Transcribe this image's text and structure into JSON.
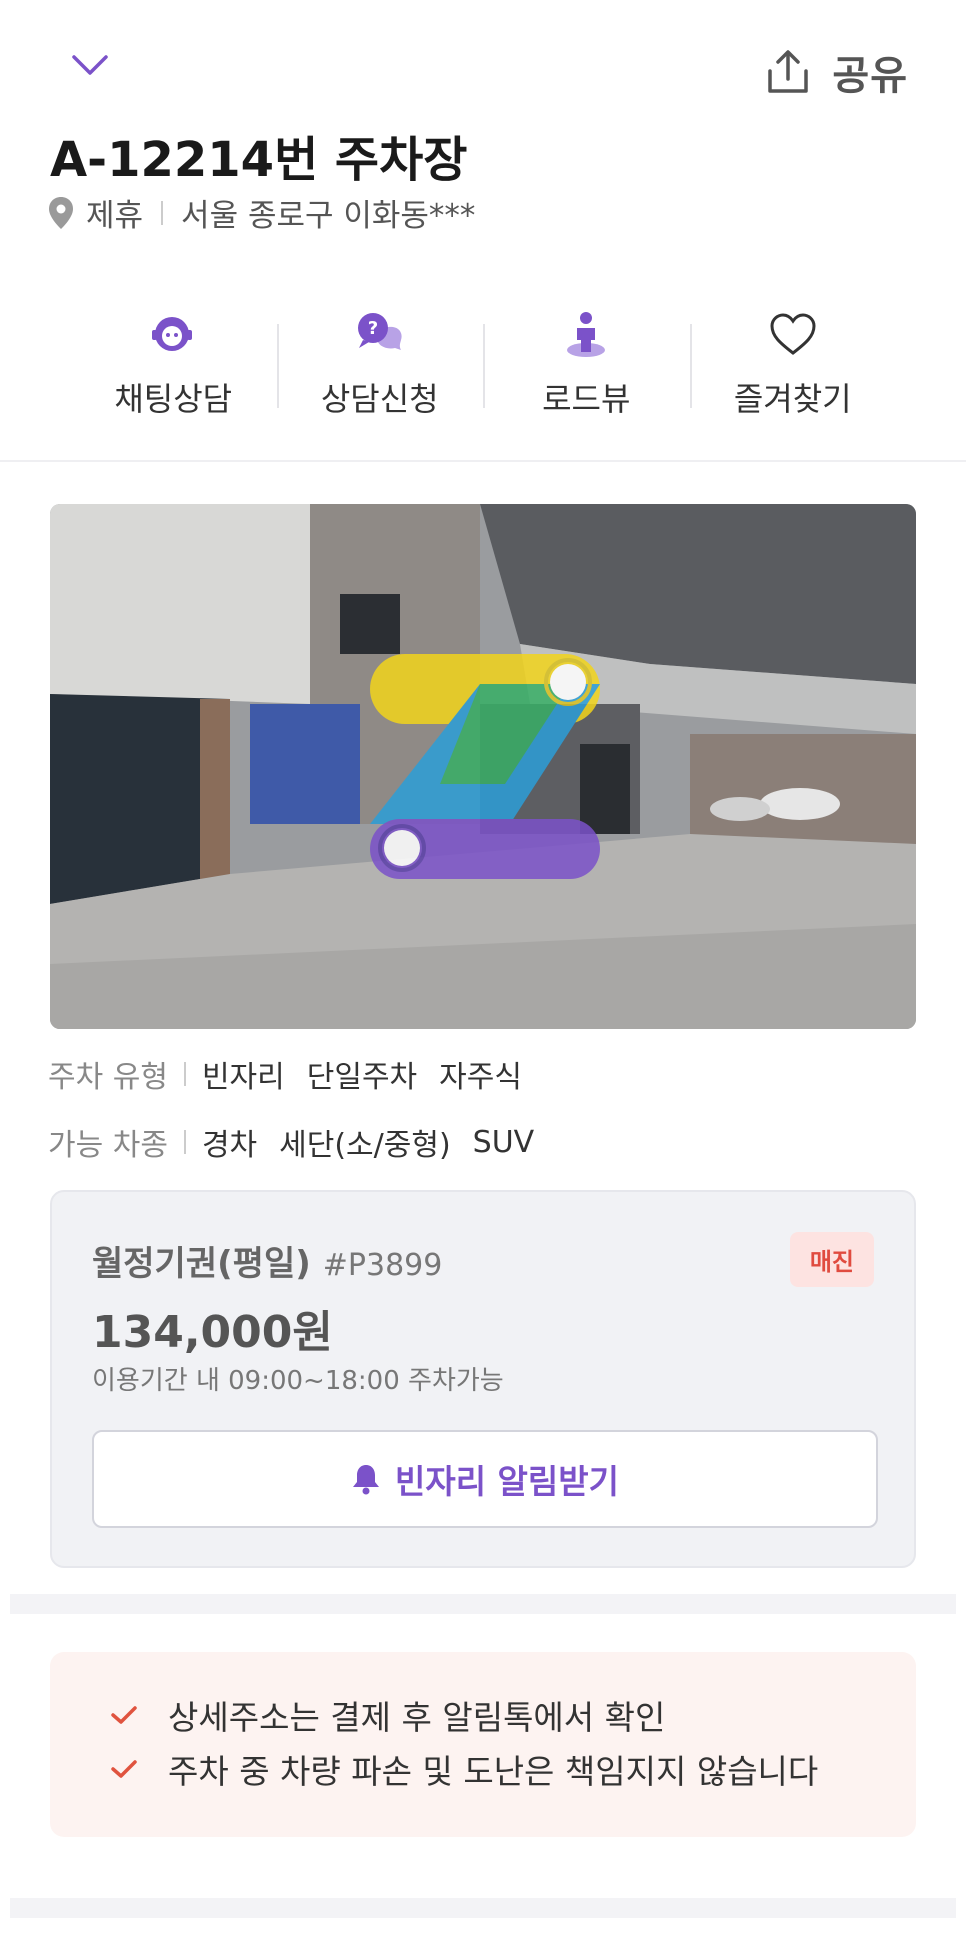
{
  "header": {
    "share_label": "공유"
  },
  "lot": {
    "title": "A-12214번 주차장",
    "partner_label": "제휴",
    "address": "서울 종로구 이화동***"
  },
  "actions": [
    {
      "label": "채팅상담",
      "icon": "chat-support-icon"
    },
    {
      "label": "상담신청",
      "icon": "consult-request-icon"
    },
    {
      "label": "로드뷰",
      "icon": "road-view-icon"
    },
    {
      "label": "즐겨찾기",
      "icon": "heart-icon"
    }
  ],
  "info": {
    "parking_type": {
      "key": "주차 유형",
      "values": [
        "빈자리",
        "단일주차",
        "자주식"
      ]
    },
    "vehicle_type": {
      "key": "가능 차종",
      "values": [
        "경차",
        "세단(소/중형)",
        "SUV"
      ]
    }
  },
  "ticket": {
    "name": "월정기권(평일)",
    "code": "#P3899",
    "badge": "매진",
    "price": "134,000원",
    "usage": "이용기간 내 09:00~18:00 주차가능",
    "notify_label": "빈자리 알림받기"
  },
  "notices": [
    "상세주소는 결제 후 알림톡에서 확인",
    "주차 중 차량 파손 및 도난은 책임지지 않습니다"
  ],
  "colors": {
    "accent": "#7b52c9",
    "badge_text": "#e04b3f",
    "badge_bg": "#fde3e1",
    "notice_bg": "#fdf3f1",
    "check": "#e0533f"
  }
}
